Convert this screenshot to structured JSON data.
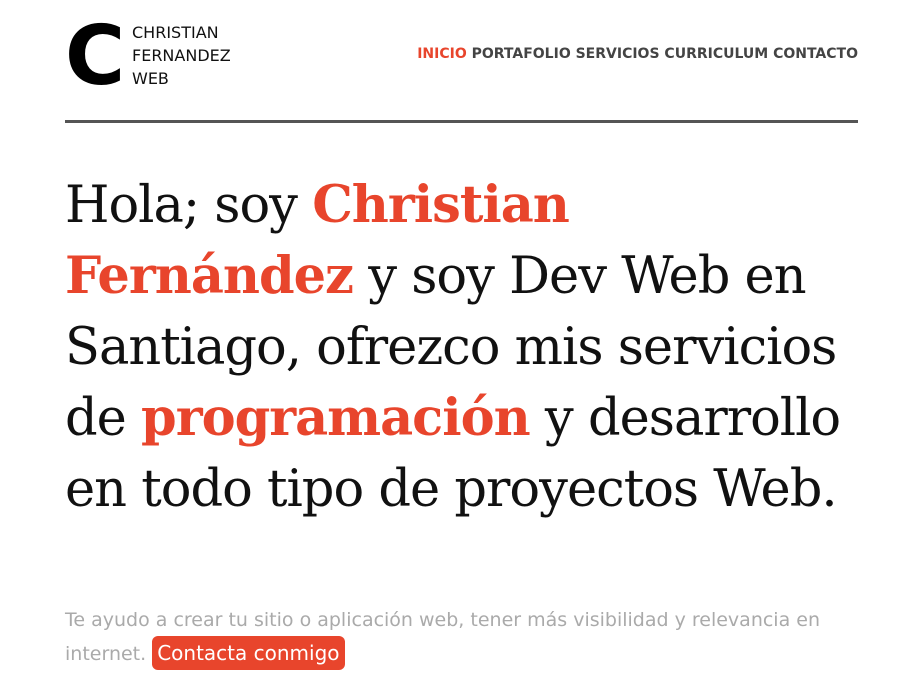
{
  "brand": {
    "mark": "C",
    "line1": "CHRISTIAN",
    "line2": "FERNANDEZ",
    "line3": "WEB"
  },
  "nav": {
    "items": [
      "INICIO",
      "PORTAFOLIO",
      "SERVICIOS",
      "CURRICULUM",
      "CONTACTO"
    ],
    "active": "INICIO"
  },
  "hero": {
    "part1": "Hola; soy ",
    "name": "Christian Fernández",
    "part2": " y soy Dev Web en Santiago, ofrezco mis servicios de ",
    "highlight": "programación",
    "part3": " y desarrollo en todo tipo de proyectos Web."
  },
  "subtext": {
    "text": "Te ayudo a crear tu sitio o aplicación web, tener más visibilidad y relevancia en internet. ",
    "cta_label": "Contacta conmigo"
  },
  "colors": {
    "accent": "#e8452c",
    "divider": "#555555",
    "muted": "#aaaaaa"
  }
}
